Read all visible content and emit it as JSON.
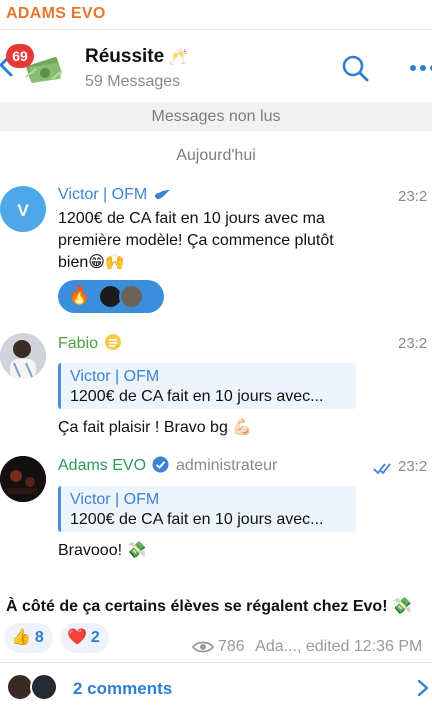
{
  "topbar": {
    "brand": "ADAMS EVO"
  },
  "header": {
    "badge": "69",
    "title": "Réussite",
    "title_emoji": "🥂",
    "subtitle": "59 Messages"
  },
  "unread_label": "Messages non lus",
  "day_label": "Aujourd'hui",
  "messages": [
    {
      "sender": "Victor | OFM",
      "avatar_letter": "V",
      "time": "23:2",
      "text_lines": [
        "1200€ de CA fait en 10 jours avec ma",
        "première modèle! Ça commence plutôt",
        "bien😁🙌"
      ],
      "reaction_emoji": "🔥"
    },
    {
      "sender": "Fabio",
      "time": "23:2",
      "reply_name": "Victor | OFM",
      "reply_text": "1200€ de CA fait en 10 jours avec...",
      "text": "Ça fait plaisir ! Bravo bg 💪🏻"
    },
    {
      "sender": "Adams EVO",
      "role": "administrateur",
      "time": "23:2",
      "reply_name": "Victor | OFM",
      "reply_text": "1200€ de CA fait en 10 jours avec...",
      "text": "Bravooo! 💸"
    }
  ],
  "post": {
    "text": "À côté de ça certains élèves se régalent chez Evo! 💸",
    "reactions": [
      {
        "emoji": "👍",
        "count": "8"
      },
      {
        "emoji": "❤️",
        "count": "2"
      }
    ],
    "views": "786",
    "footer": "Ada..., edited 12:36 PM"
  },
  "comments": {
    "label": "2 comments"
  },
  "colors": {
    "accent": "#2f7fd0",
    "brand": "#e8762b",
    "fabio": "#4aa33a",
    "adams": "#2e9a5a",
    "badge": "#e53935"
  }
}
